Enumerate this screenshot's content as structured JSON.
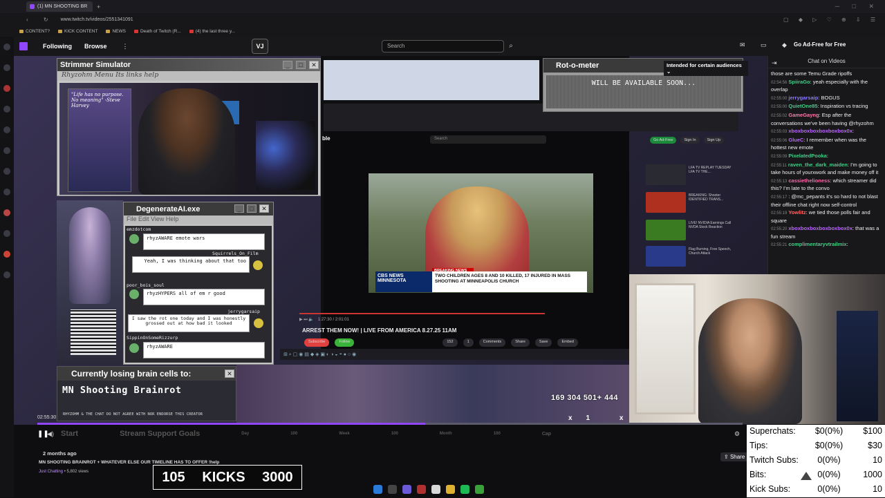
{
  "browser": {
    "tab_title": "(1) MN SHOOTING BR",
    "url": "www.twitch.tv/videos/2551341091",
    "bookmarks": [
      "CONTENT?",
      "KICK CONTENT",
      "NEWS",
      "Death of Twitch (R...",
      "(4) the last three y..."
    ]
  },
  "twitch": {
    "nav_following": "Following",
    "nav_browse": "Browse",
    "more": "⋮",
    "search_placeholder": "Search",
    "ad_free": "Go Ad-Free for Free",
    "chat_header": "Chat on Videos",
    "audience_notice": "Intended for certain audiences ⌄"
  },
  "chat": [
    {
      "ts": "",
      "user": "",
      "color": "#ddd",
      "text": "those are some Temu Grade ripoffs"
    },
    {
      "ts": "02:54:56",
      "user": "SpiiraGo",
      "color": "#44cc88",
      "text": ": yeah especially with the overlap"
    },
    {
      "ts": "02:55:00",
      "user": "jerrygarsaip",
      "color": "#8a7aff",
      "text": ": BOGUS"
    },
    {
      "ts": "02:55:00",
      "user": "QuietOne85",
      "color": "#44cc88",
      "text": ": Inspiration vs tracing"
    },
    {
      "ts": "02:55:02",
      "user": "GameGayng",
      "color": "#ff77aa",
      "text": ": Esp after the conversations we've been having @rhyzohm"
    },
    {
      "ts": "02:55:03",
      "user": "xboxboxboxboxboxbox0x",
      "color": "#bb66ff",
      "text": ":"
    },
    {
      "ts": "02:55:06",
      "user": "GlueC",
      "color": "#bb66ff",
      "text": ": I remember when was the hottest new emote"
    },
    {
      "ts": "02:55:09",
      "user": "PixelatedPooka",
      "color": "#44cc88",
      "text": ":"
    },
    {
      "ts": "02:55:11",
      "user": "raven_the_dark_maiden",
      "color": "#44cc88",
      "text": ": I'm going to take hours of yourxwork and make money off it"
    },
    {
      "ts": "02:55:13",
      "user": "cassiethelioness",
      "color": "#ff66aa",
      "text": ": which streamer did this? I'm late to the convo"
    },
    {
      "ts": "02:55:17",
      "user": "",
      "color": "#4488ff",
      "text": ": @mc_pepants it's so hard to not blast their offline chat right now self-control"
    },
    {
      "ts": "02:55:19",
      "user": "Yowlitz",
      "color": "#ff6666",
      "text": ": we tied those polls fair and square"
    },
    {
      "ts": "02:55:20",
      "user": "xboxboxboxboxboxbox0x",
      "color": "#bb66ff",
      "text": ": that was a fun stream"
    },
    {
      "ts": "02:55:21",
      "user": "complimentaryvtrailmix",
      "color": "#44cc88",
      "text": ":"
    }
  ],
  "overlay": {
    "strimmer_title": "Strimmer Simulator",
    "strimmer_menu": "Rhyzohm Menu Its links help",
    "poster_quote": "\"Life has no purpose. No meaning\" -Steve Harvey",
    "rot_title": "Rot-o-meter",
    "rot_text": "WILL BE AVAILABLE SOON...",
    "degen_title": "DegenerateAI.exe",
    "degen_menu": "File  Edit  View  Help",
    "degen_chat": [
      {
        "user": "emzdotcom",
        "msg": "rhyzAWARE emote wars"
      },
      {
        "user": "Squirrels_On_Film",
        "msg": "Yeah, I was thinking about that too"
      },
      {
        "user": "poor_bois_soul",
        "msg": "rhyzHYPERS all of em r good"
      },
      {
        "user": "jerrygarsaip",
        "msg": "I saw the rot one today and I was honestly grossed out at how bad it looked"
      },
      {
        "user": "SippinOnSomeRizzurp",
        "msg": "rhyzAWARE"
      }
    ],
    "brain_title": "Currently losing brain cells to:",
    "brain_topic": "MN Shooting Brainrot",
    "brain_disclaimer": "RHYZOHM & THE CHAT DO NOT AGREE WITH NOR ENDORSE THIS CREATOR",
    "counts": "169  304  501+  444",
    "multipliers": "x1 x1 x1"
  },
  "news": {
    "breaking": "BREAKING NEWS",
    "network": "CBS NEWS MINNESOTA",
    "headline": "TWO CHILDREN AGES 8 AND 10 KILLED, 17 INJURED IN MASS SHOOTING AT MINNEAPOLIS CHURCH",
    "video_title": "ARREST THEM NOW! | LIVE FROM AMERICA 8.27.25 11AM",
    "player_time": "1:27:30 / 2:01:01",
    "rumble_search": "Search",
    "rumble_buttons": [
      "Go Ad-Free",
      "Sign In",
      "Sign Up"
    ],
    "action_buttons": [
      "Subscribe",
      "Follow",
      "152",
      "1",
      "Comments",
      "Share",
      "Save",
      "Embed"
    ],
    "recs": [
      "LFA TV REPLAY TUESDAY LFA TV THE...",
      "BREAKING: Shooter IDENTIFIED TRANS...",
      "LIVE! NVIDIA Earnings Call NVDA Stock Reaction",
      "Flag Burning, Free Speech, Church Attack"
    ]
  },
  "player": {
    "timecode": "02:55:30",
    "progress_percent": 55,
    "goal_start": "Start",
    "goal_label": "Stream Support Goals",
    "goal_marks": [
      "Day",
      "100",
      "Week",
      "100",
      "Month",
      "100"
    ],
    "goal_cap": "Cap",
    "share": "Share",
    "date": "2 months ago",
    "title": "MN SHOOTING BRAINROT + WHATEVER ELSE OUR TIMELINE HAS TO OFFER !help",
    "category": "Just Chatting",
    "views": " • 5,802 views"
  },
  "kicks_box": {
    "left": "105",
    "label": "KICKS",
    "right": "3000"
  },
  "stats": [
    {
      "label": "Superchats:",
      "pct": "$0(0%)",
      "target": "$100"
    },
    {
      "label": "Tips:",
      "pct": "$0(0%)",
      "target": "$30"
    },
    {
      "label": "Twitch Subs:",
      "pct": "0(0%)",
      "target": "10"
    },
    {
      "label": "Bits:",
      "pct": "0(0%)",
      "target": "1000"
    },
    {
      "label": "Kick Subs:",
      "pct": "0(0%)",
      "target": "10"
    }
  ],
  "colors": {
    "twitch_purple": "#9146ff",
    "chat_bg": "#18181b"
  }
}
